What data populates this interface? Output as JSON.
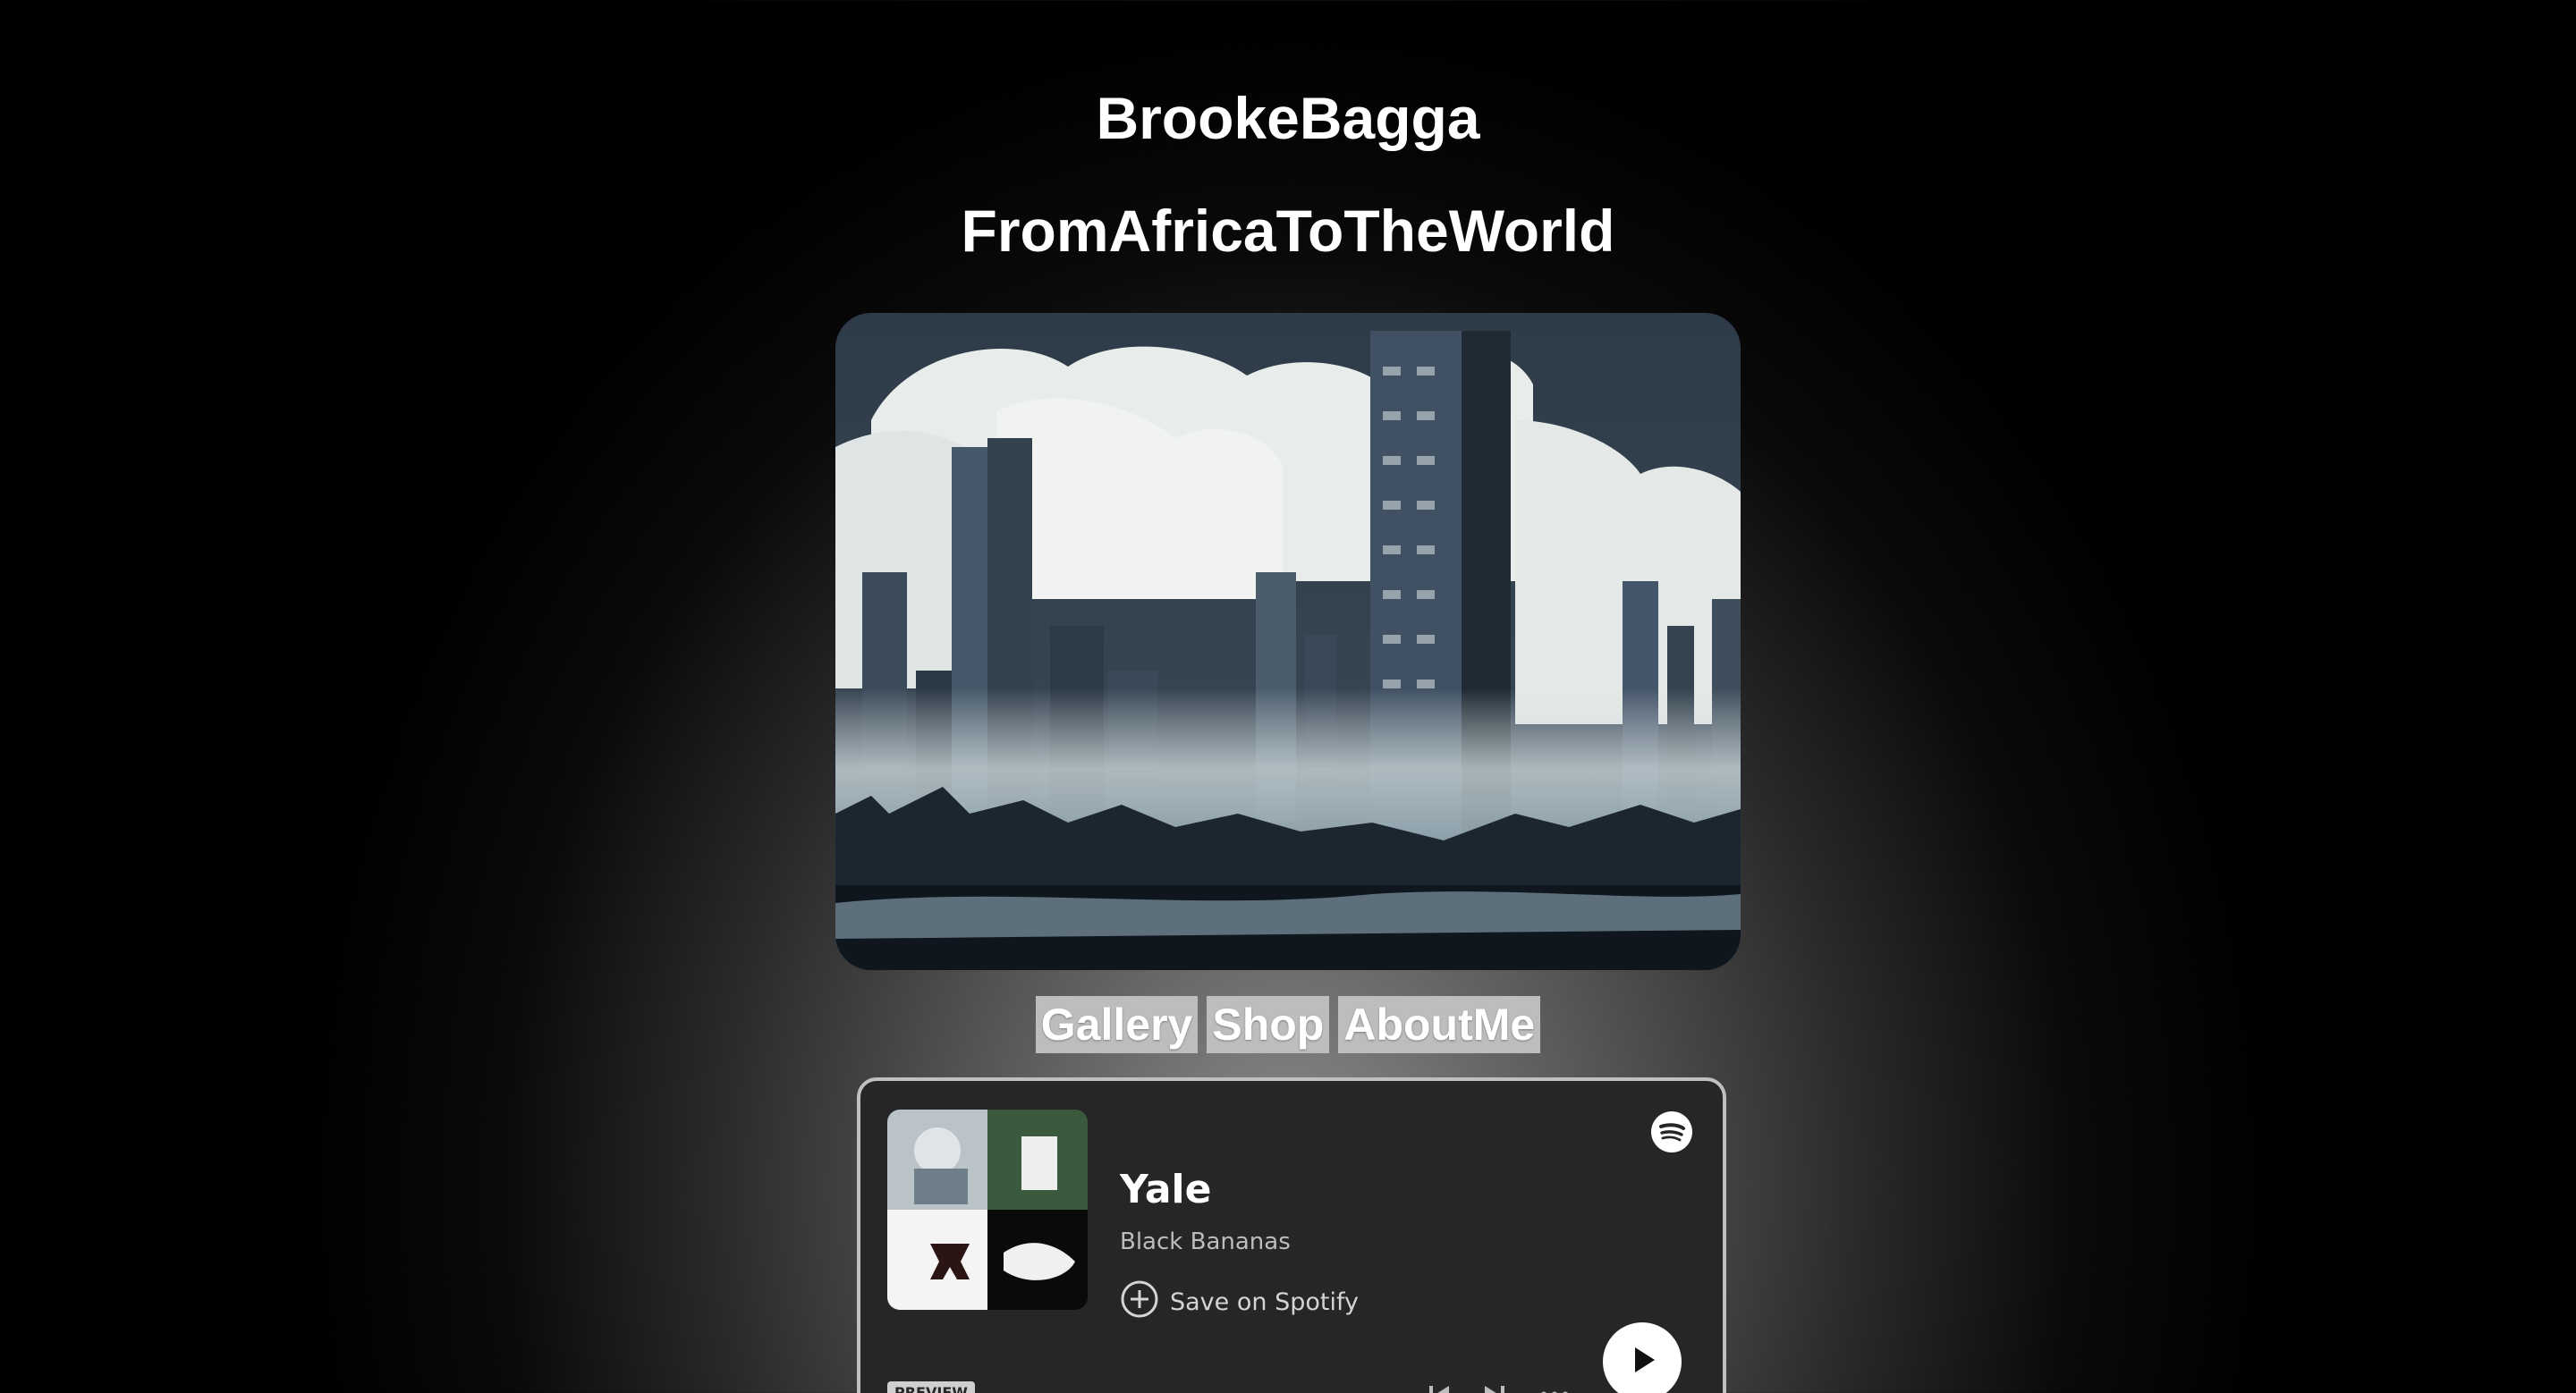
{
  "header": {
    "title": "BrookeBagga",
    "subtitle": "FromAfricaToTheWorld"
  },
  "hero": {
    "image_description_icon": "city-skyline-artwork"
  },
  "nav": {
    "items": [
      {
        "label": "Gallery"
      },
      {
        "label": "Shop"
      },
      {
        "label": "AboutMe"
      }
    ]
  },
  "player": {
    "track_title": "Yale",
    "artist": "Black Bananas",
    "save_label": "Save on Spotify",
    "preview_label": "PREVIEW",
    "icons": {
      "brand": "spotify-icon",
      "save": "plus-circle-icon",
      "play": "play-icon",
      "previous": "skip-back-icon",
      "next": "skip-forward-icon",
      "more": "more-icon"
    }
  },
  "colors": {
    "player_background": "#262626",
    "nav_button": "#bdbdbd"
  }
}
